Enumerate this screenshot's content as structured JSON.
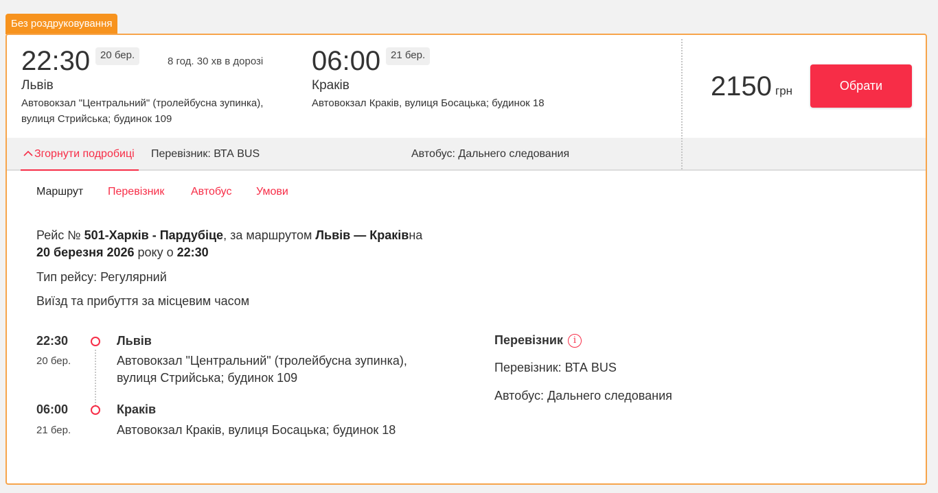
{
  "badge": "Без роздруковування",
  "departure": {
    "time": "22:30",
    "date": "20 бер.",
    "city": "Львів",
    "address_line1": "Автовокзал \"Центральний\" (тролейбусна зупинка),",
    "address_line2": "вулиця Стрийська; будинок 109"
  },
  "duration": "8 год. 30 хв в дорозі",
  "arrival": {
    "time": "06:00",
    "date": "21 бер.",
    "city": "Краків",
    "address": "Автовокзал Краків, вулиця Босацька; будинок 18"
  },
  "price": {
    "amount": "2150",
    "currency": "грн"
  },
  "choose_button": "Обрати",
  "details_bar": {
    "collapse_label": "Згорнути подробиці",
    "carrier": "Перевізник: ВТА BUS",
    "bus": "Автобус: Дальнего следования"
  },
  "tabs": [
    "Маршрут",
    "Перевізник",
    "Автобус",
    "Умови"
  ],
  "route_info": {
    "prefix": "Рейс № ",
    "trip_number": "501-Харків - Пардубіце",
    "route_prefix": ", за маршрутом ",
    "route": "Львів — Краків",
    "on": "на",
    "date": "20 березня 2026",
    "year_suffix": " року о ",
    "time": "22:30",
    "trip_type": "Тип рейсу: Регулярний",
    "local_time_note": "Виїзд та прибуття за місцевим часом"
  },
  "stops": [
    {
      "time": "22:30",
      "date": "20 бер.",
      "city": "Львів",
      "address_line1": "Автовокзал \"Центральний\" (тролейбусна зупинка),",
      "address_line2": "вулиця Стрийська; будинок 109"
    },
    {
      "time": "06:00",
      "date": "21 бер.",
      "city": "Краків",
      "address_line1": "Автовокзал Краків, вулиця Босацька; будинок 18"
    }
  ],
  "carrier_section": {
    "heading": "Перевізник",
    "info_icon": "i",
    "carrier": "Перевізник: ВТА BUS",
    "bus": "Автобус: Дальнего следования"
  },
  "colors": {
    "accent": "#f72d47",
    "badge": "#f7931e",
    "border": "#f7a44a"
  },
  "icons": {
    "collapse": "chevron-up-icon",
    "info": "info-icon",
    "stop": "circle-stop-icon"
  }
}
